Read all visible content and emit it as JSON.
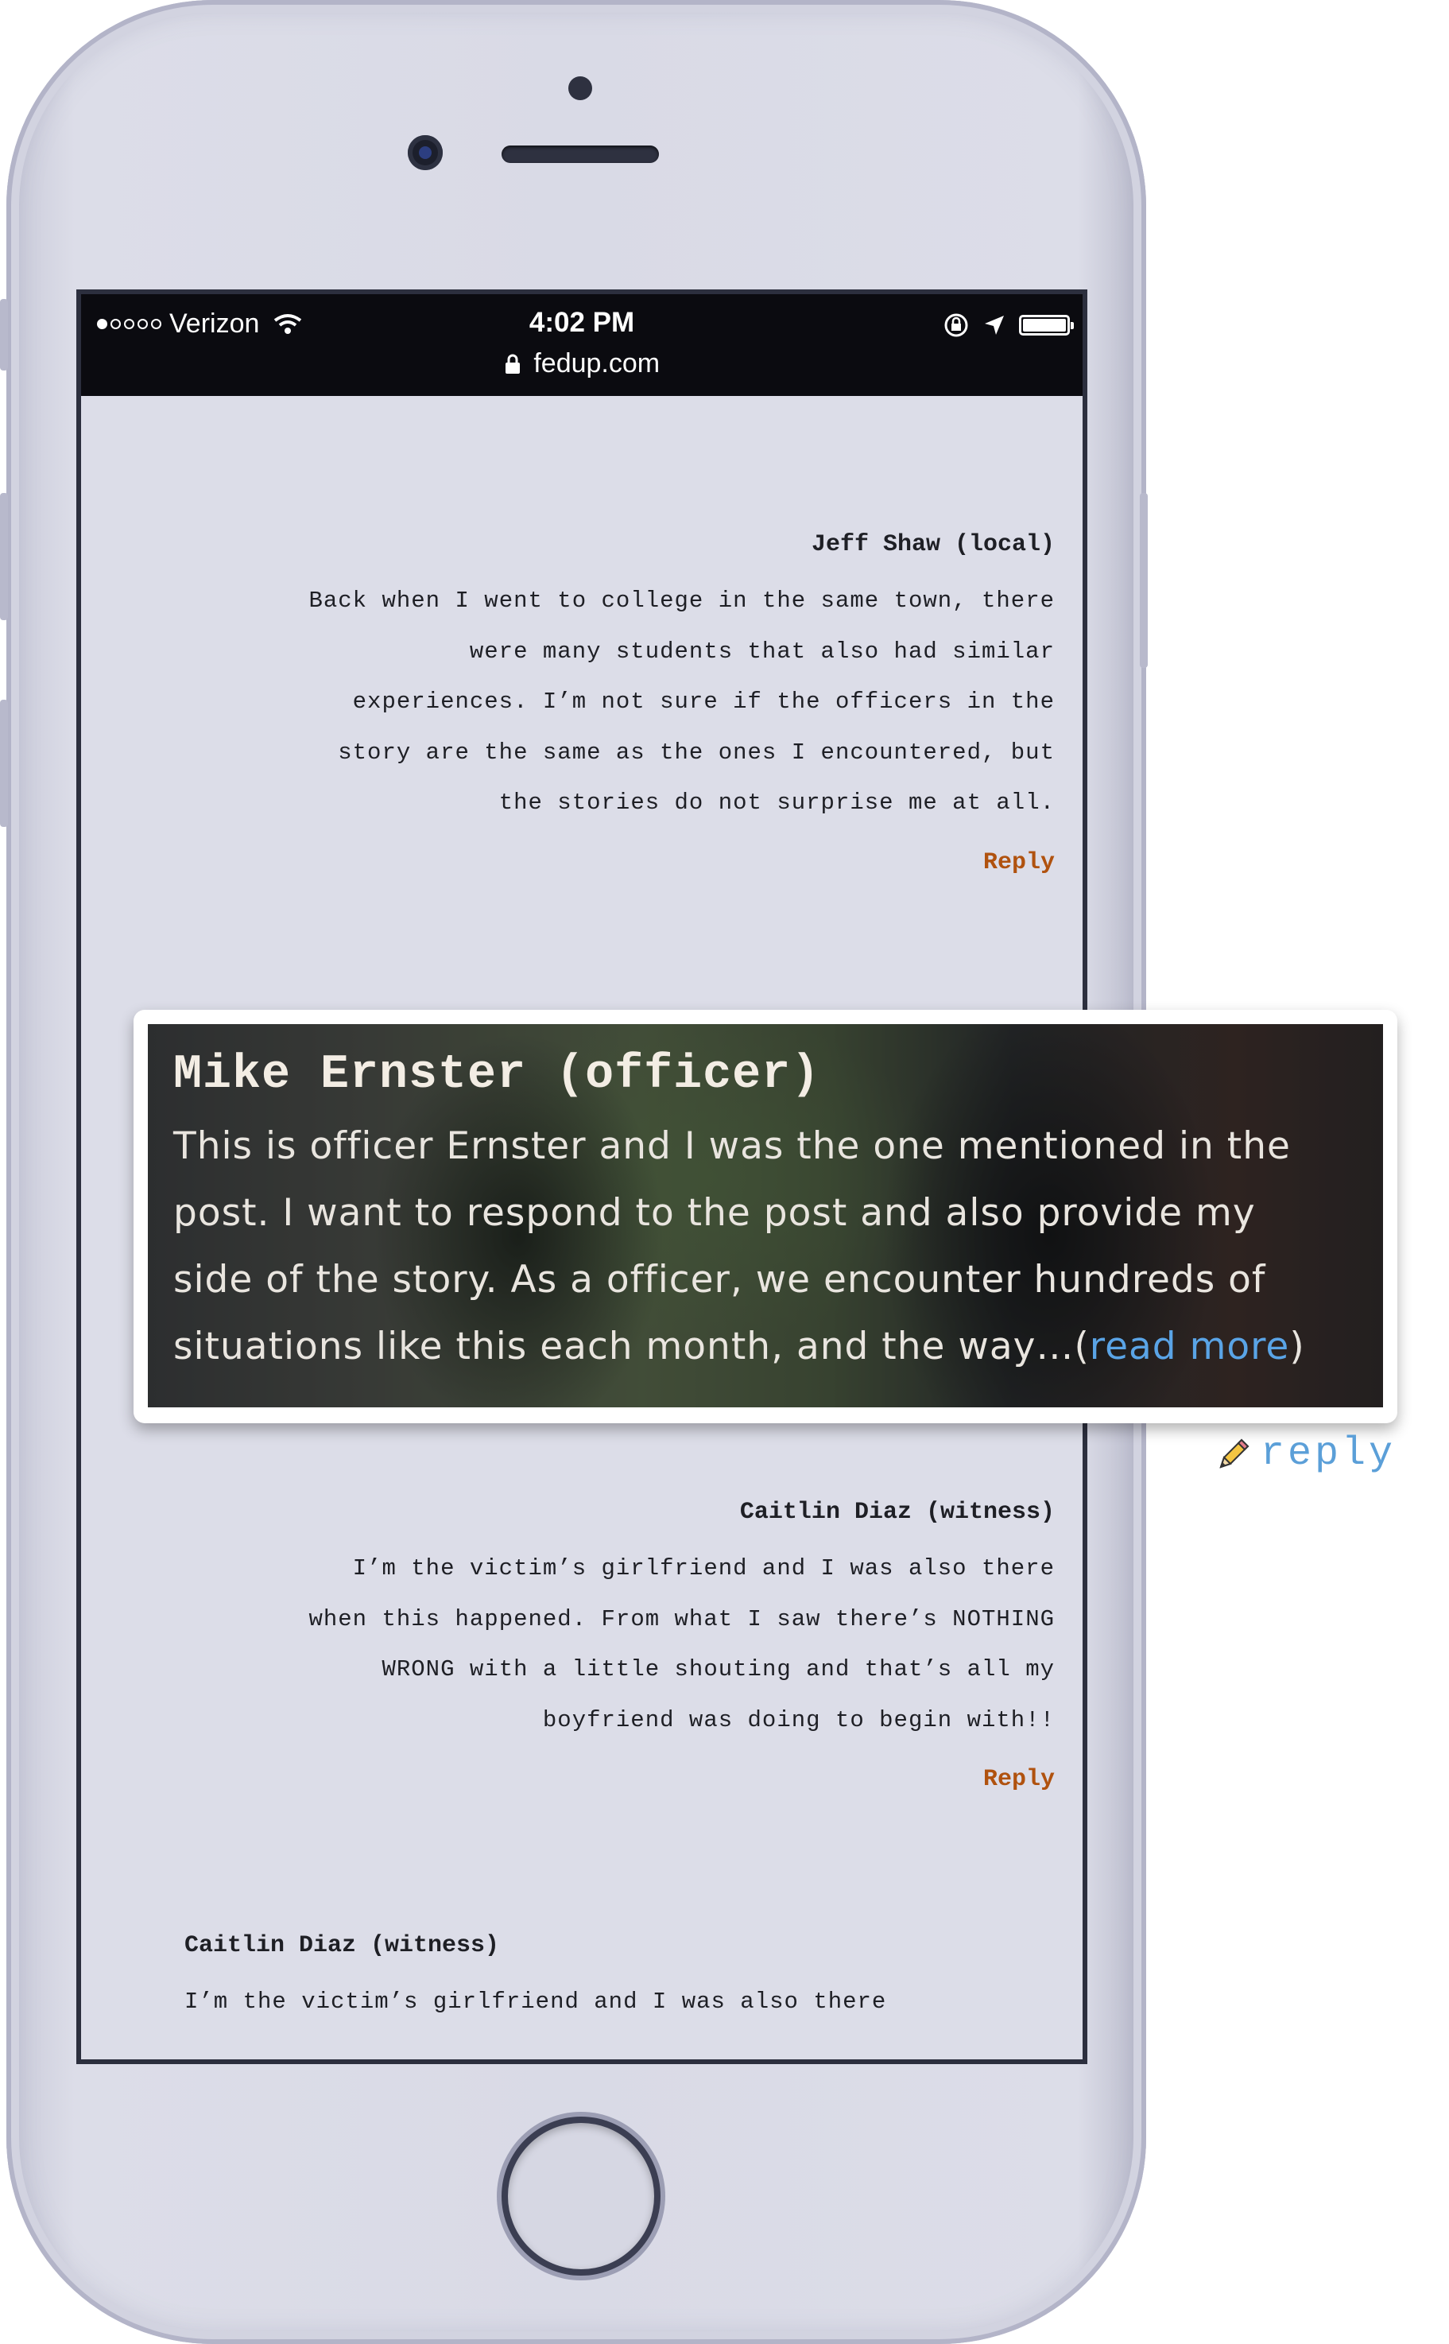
{
  "status_bar": {
    "carrier": "Verizon",
    "time": "4:02 PM",
    "url": "fedup.com"
  },
  "comments": [
    {
      "author": "Jeff Shaw (local)",
      "lines": [
        "Back when I went to college in the same town, there",
        "were many students that also had similar",
        "experiences. I’m not sure if the officers in the",
        "story are the same as the ones I encountered, but",
        "the stories do not surprise me at all."
      ],
      "reply_label": "Reply"
    },
    {
      "author": "Caitlin Diaz (witness)",
      "lines": [
        "I’m the victim’s girlfriend and I was also there",
        "when this happened. From what I saw there’s NOTHING",
        "WRONG with a little shouting and that’s all my",
        "boyfriend was doing to begin with!!"
      ],
      "reply_label": "Reply"
    },
    {
      "author": "Caitlin Diaz (witness)",
      "lines": [
        "I’m the victim’s girlfriend and I was also there"
      ]
    }
  ],
  "featured": {
    "author": "Mike Ernster (officer)",
    "lines": [
      "This is officer Ernster and I was the one mentioned in the",
      "post. I want to respond to the post and also provide my",
      "side of the story. As a officer, we encounter hundreds of",
      "situations like this each month, and the way…"
    ],
    "read_more_open": "(",
    "read_more": "read more",
    "read_more_close": ")",
    "reply_label": "reply",
    "reply_icon": "pencil-icon"
  },
  "colors": {
    "reply": "#b0520f",
    "read_more": "#5aa4e6",
    "reply_link": "#5b9fd8"
  }
}
